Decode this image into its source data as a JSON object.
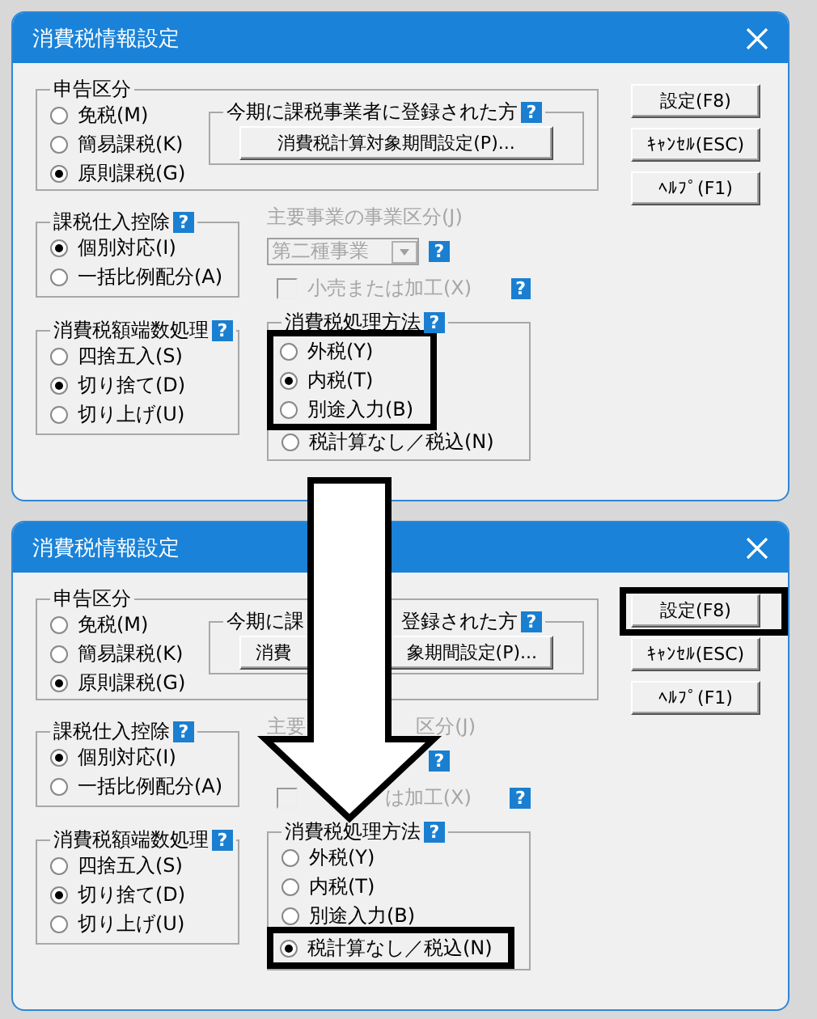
{
  "dialogs": [
    {
      "title": "消費税情報設定",
      "filing": {
        "title": "申告区分",
        "options": [
          {
            "label": "免税(M)",
            "selected": false,
            "highlighted": false
          },
          {
            "label": "簡易課税(K)",
            "selected": false,
            "highlighted": false
          },
          {
            "label": "原則課税(G)",
            "selected": true,
            "highlighted": false
          }
        ],
        "registered": {
          "title": {
            "left": "今期に課税事業者に登録された方"
          },
          "help": "?",
          "button": {
            "left": "消費税計算対象期間設定(P)..."
          }
        }
      },
      "buttons": [
        {
          "label": "設定(F8)",
          "highlighted": false
        },
        {
          "label": "ｷｬﾝｾﾙ(ESC)",
          "highlighted": false
        },
        {
          "label": "ﾍﾙﾌﾟ(F1)",
          "highlighted": false
        }
      ],
      "deduction": {
        "title": "課税仕入控除",
        "help": "?",
        "options": [
          {
            "label": "個別対応(I)",
            "selected": true,
            "highlighted": false
          },
          {
            "label": "一括比例配分(A)",
            "selected": false,
            "highlighted": false
          }
        ]
      },
      "main_business": {
        "label": {
          "left": "主要事業の事業区分(J)"
        },
        "disabled": true,
        "dropdown": {
          "value": "第二種事業",
          "help": "?"
        },
        "checkbox": {
          "label": {
            "left": "小売または加工(X)"
          },
          "checked": false,
          "help": "?"
        }
      },
      "rounding": {
        "title": "消費税額端数処理",
        "help": "?",
        "options": [
          {
            "label": "四捨五入(S)",
            "selected": false,
            "highlighted": false
          },
          {
            "label": "切り捨て(D)",
            "selected": true,
            "highlighted": false
          },
          {
            "label": "切り上げ(U)",
            "selected": false,
            "highlighted": false
          }
        ]
      },
      "method": {
        "title": "消費税処理方法",
        "help": "?",
        "options": [
          {
            "label": "外税(Y)",
            "selected": false,
            "highlighted": true
          },
          {
            "label": "内税(T)",
            "selected": true,
            "highlighted": true
          },
          {
            "label": "別途入力(B)",
            "selected": false,
            "highlighted": true
          },
          {
            "label": "税計算なし／税込(N)",
            "selected": false,
            "highlighted": false
          }
        ]
      }
    },
    {
      "title": "消費税情報設定",
      "filing": {
        "title": "申告区分",
        "options": [
          {
            "label": "免税(M)",
            "selected": false,
            "highlighted": false
          },
          {
            "label": "簡易課税(K)",
            "selected": false,
            "highlighted": false
          },
          {
            "label": "原則課税(G)",
            "selected": true,
            "highlighted": false
          }
        ],
        "registered": {
          "title": {
            "left": "今期に課",
            "right": "登録された方"
          },
          "help": "?",
          "button": {
            "left": "消費",
            "right": "象期間設定(P)..."
          }
        }
      },
      "buttons": [
        {
          "label": "設定(F8)",
          "highlighted": true
        },
        {
          "label": "ｷｬﾝｾﾙ(ESC)",
          "highlighted": false
        },
        {
          "label": "ﾍﾙﾌﾟ(F1)",
          "highlighted": false
        }
      ],
      "deduction": {
        "title": "課税仕入控除",
        "help": "?",
        "options": [
          {
            "label": "個別対応(I)",
            "selected": true,
            "highlighted": false
          },
          {
            "label": "一括比例配分(A)",
            "selected": false,
            "highlighted": false
          }
        ]
      },
      "main_business": {
        "label": {
          "left": "主要",
          "right": "区分(J)"
        },
        "disabled": true,
        "dropdown": {
          "help": "?"
        },
        "checkbox": {
          "label": {
            "right": "は加工(X)"
          },
          "checked": false,
          "help": "?"
        }
      },
      "rounding": {
        "title": "消費税額端数処理",
        "help": "?",
        "options": [
          {
            "label": "四捨五入(S)",
            "selected": false,
            "highlighted": false
          },
          {
            "label": "切り捨て(D)",
            "selected": true,
            "highlighted": false
          },
          {
            "label": "切り上げ(U)",
            "selected": false,
            "highlighted": false
          }
        ]
      },
      "method": {
        "title": "消費税処理方法",
        "help": "?",
        "options": [
          {
            "label": "外税(Y)",
            "selected": false,
            "highlighted": false
          },
          {
            "label": "内税(T)",
            "selected": false,
            "highlighted": false
          },
          {
            "label": "別途入力(B)",
            "selected": false,
            "highlighted": false
          },
          {
            "label": "税計算なし／税込(N)",
            "selected": true,
            "highlighted": true
          }
        ]
      }
    }
  ]
}
